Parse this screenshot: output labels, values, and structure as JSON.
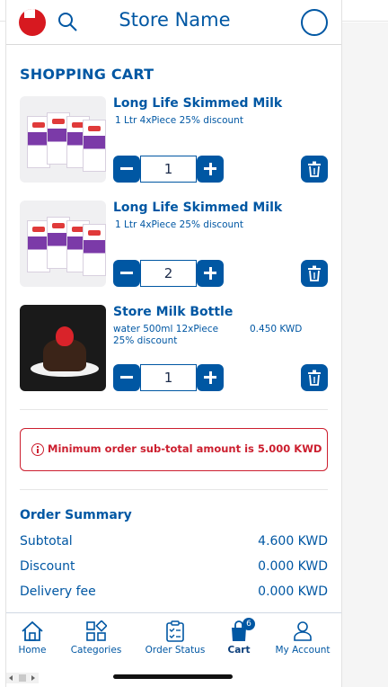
{
  "header": {
    "store_name": "Store Name",
    "flag_icon": "flag-icon",
    "search_icon": "search-icon"
  },
  "cart": {
    "title": "SHOPPING CART",
    "items": [
      {
        "name": "Long Life Skimmed Milk",
        "description": "1 Ltr 4xPiece 25% discount",
        "price": "",
        "quantity": "1",
        "image": "milk-cartons"
      },
      {
        "name": "Long Life Skimmed Milk",
        "description": "1 Ltr 4xPiece 25% discount",
        "price": "",
        "quantity": "2",
        "image": "milk-cartons"
      },
      {
        "name": "Store Milk Bottle",
        "description": "water 500ml 12xPiece 25% discount",
        "price": "0.450 KWD",
        "quantity": "1",
        "image": "cake-dessert"
      }
    ]
  },
  "alert": {
    "message": "Minimum order sub-total amount is 5.000 KWD"
  },
  "summary": {
    "title": "Order Summary",
    "rows": [
      {
        "label": "Subtotal",
        "value": "4.600 KWD"
      },
      {
        "label": "Discount",
        "value": "0.000 KWD"
      },
      {
        "label": "Delivery fee",
        "value": "0.000 KWD"
      }
    ]
  },
  "nav": {
    "items": [
      {
        "label": "Home",
        "icon": "home-icon"
      },
      {
        "label": "Categories",
        "icon": "categories-icon"
      },
      {
        "label": "Order Status",
        "icon": "clipboard-icon"
      },
      {
        "label": "Cart",
        "icon": "shopping-bag-icon",
        "badge": "6",
        "active": true
      },
      {
        "label": "My Account",
        "icon": "user-icon"
      }
    ]
  },
  "colors": {
    "primary": "#0057a3",
    "danger": "#cc1f2f"
  }
}
